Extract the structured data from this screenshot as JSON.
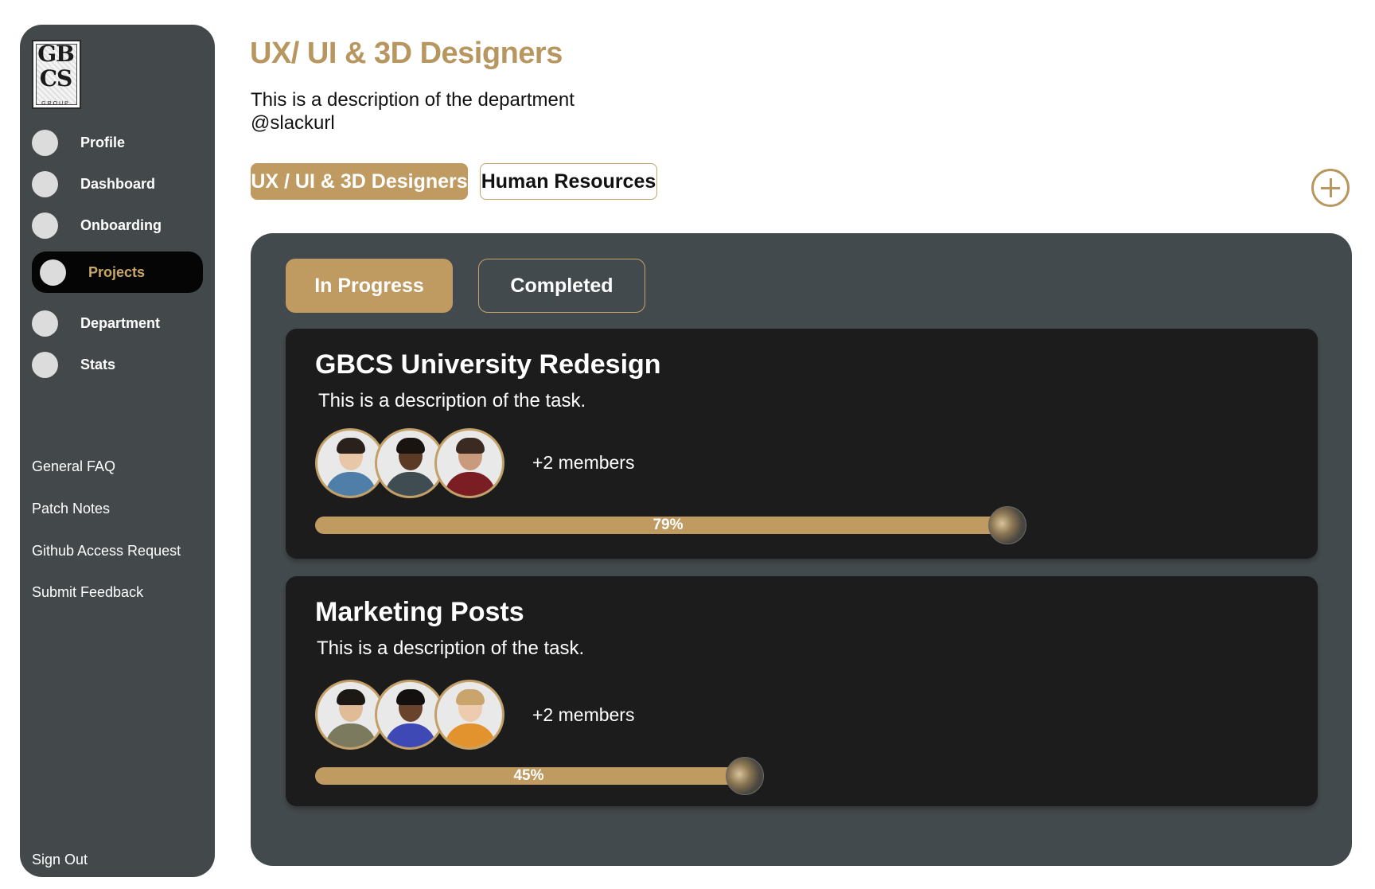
{
  "sidebar": {
    "logo": {
      "text": "GB CS",
      "sub": "GROUP"
    },
    "nav": [
      {
        "label": "Profile"
      },
      {
        "label": "Dashboard"
      },
      {
        "label": "Onboarding"
      },
      {
        "label": "Projects",
        "active": true
      },
      {
        "label": "Department"
      },
      {
        "label": "Stats"
      }
    ],
    "links": [
      "General FAQ",
      "Patch Notes",
      "Github Access Request",
      "Submit Feedback"
    ],
    "sign_out": "Sign Out"
  },
  "header": {
    "title": "UX/ UI & 3D Designers",
    "description": "This is a description of the department",
    "slack": "@slackurl"
  },
  "departments": [
    {
      "label": "UX / UI & 3D Designers",
      "active": true
    },
    {
      "label": "Human Resources",
      "active": false
    }
  ],
  "status_tabs": [
    {
      "label": "In Progress",
      "active": true
    },
    {
      "label": "Completed",
      "active": false
    }
  ],
  "projects": [
    {
      "title": "GBCS University Redesign",
      "description": "This is a description of the task.",
      "members": "+2 members",
      "progress": 79,
      "progress_label": "79%"
    },
    {
      "title": "Marketing Posts",
      "description": "This is a description of the task.",
      "members": "+2 members",
      "progress": 45,
      "progress_label": "45%"
    }
  ],
  "colors": {
    "accent": "#bf9b62",
    "panel": "#434a4d",
    "card": "#1c1c1c",
    "sidebar": "#43484b"
  },
  "icons": {
    "add": "plus-circle-icon",
    "nav": "circle-icon"
  }
}
